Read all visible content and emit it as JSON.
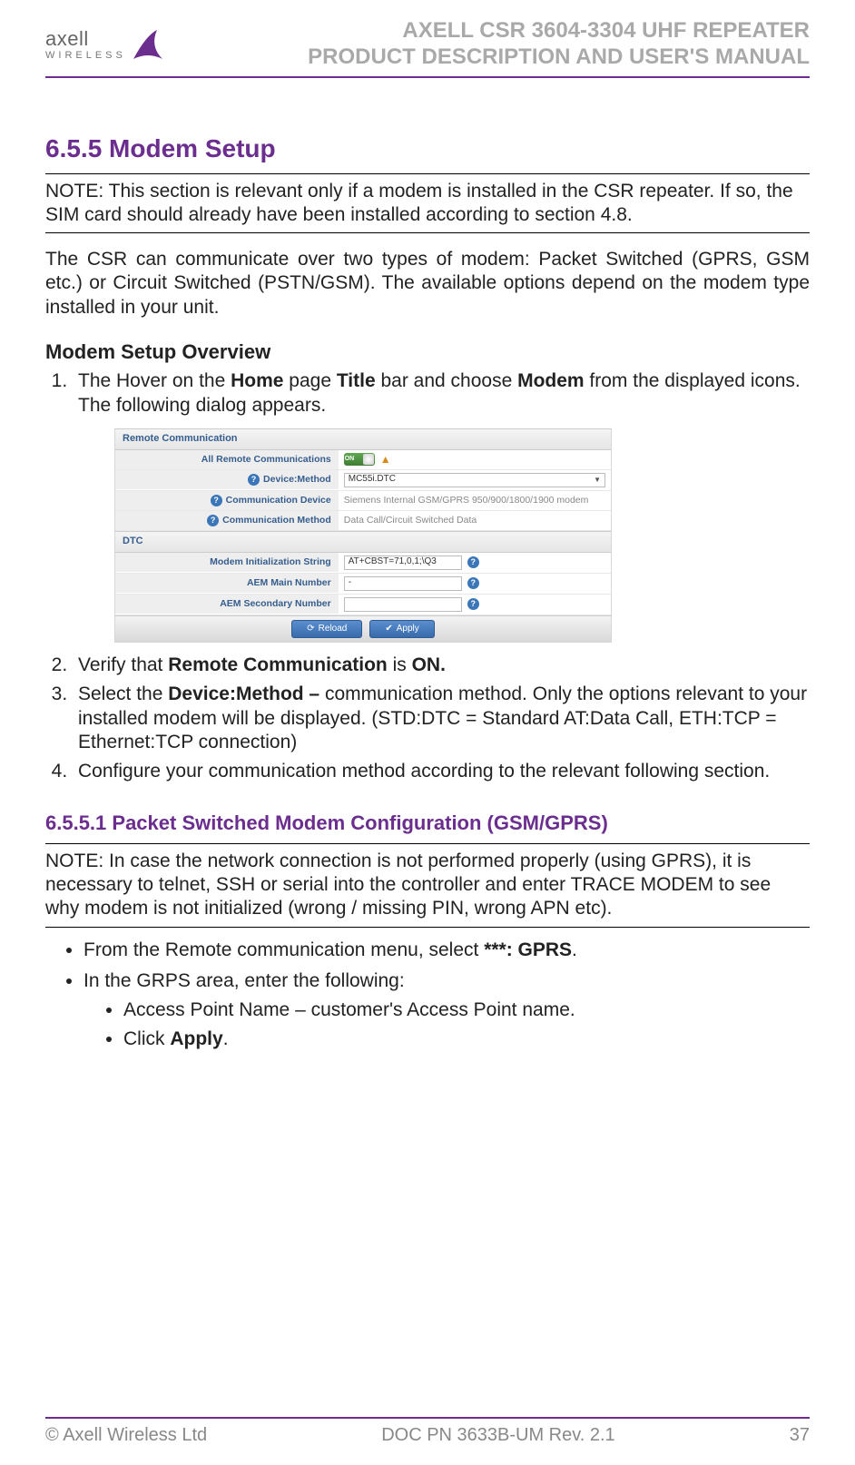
{
  "header": {
    "company": "axell",
    "subbrand": "WIRELESS",
    "title_line1": "AXELL CSR 3604-3304 UHF REPEATER",
    "title_line2": "PRODUCT DESCRIPTION AND USER'S MANUAL"
  },
  "section": {
    "number_title": "6.5.5 Modem Setup",
    "note": "NOTE: This section is relevant only if a modem is installed in the CSR repeater. If so, the SIM card should already have been installed according to section 4.8.",
    "intro": "The CSR can communicate over two types of modem: Packet Switched (GPRS, GSM etc.) or Circuit Switched (PSTN/GSM). The available options depend on the modem type installed in your unit.",
    "overview_head": "Modem Setup Overview",
    "steps": {
      "s1_a": "The Hover on the ",
      "s1_b": "Home",
      "s1_c": " page ",
      "s1_d": "Title",
      "s1_e": " bar and choose ",
      "s1_f": "Modem",
      "s1_g": " from the displayed icons. The following dialog appears.",
      "s2_a": "Verify that ",
      "s2_b": "Remote Communication",
      "s2_c": " is ",
      "s2_d": "ON.",
      "s3_a": "Select the ",
      "s3_b": "Device:Method – ",
      "s3_c": "communication method. Only the options relevant to your installed modem will be displayed. (STD:DTC = Standard AT:Data Call, ETH:TCP = Ethernet:TCP connection)",
      "s4": "Configure your communication method according to the relevant following section."
    }
  },
  "ui": {
    "panel1_title": "Remote Communication",
    "row1_label": "All Remote Communications",
    "row1_toggle": "ON",
    "row2_label": "Device:Method",
    "row2_value": "MC55i.DTC",
    "row3_label": "Communication Device",
    "row3_value": "Siemens Internal GSM/GPRS 950/900/1800/1900 modem",
    "row4_label": "Communication Method",
    "row4_value": "Data Call/Circuit Switched Data",
    "panel2_title": "DTC",
    "row5_label": "Modem Initialization String",
    "row5_value": "AT+CBST=71,0,1;\\Q3",
    "row6_label": "AEM Main Number",
    "row6_value": "-",
    "row7_label": "AEM Secondary Number",
    "row7_value": "",
    "btn_reload": "Reload",
    "btn_apply": "Apply"
  },
  "subsection": {
    "title": "6.5.5.1   Packet Switched Modem Configuration (GSM/GPRS)",
    "note": "NOTE: In case the network connection is not performed properly (using GPRS), it is necessary to telnet, SSH or serial into the controller and enter TRACE MODEM to see why modem is not initialized (wrong / missing PIN, wrong APN etc).",
    "b1_a": "From the Remote communication menu, select ",
    "b1_b": "***: GPRS",
    "b1_c": ".",
    "b2": "In the GRPS area, enter the following:",
    "sb1": " Access Point Name – customer's Access Point name.",
    "sb2_a": "Click ",
    "sb2_b": "Apply",
    "sb2_c": "."
  },
  "footer": {
    "left": "© Axell Wireless Ltd",
    "center": "DOC PN 3633B-UM Rev. 2.1",
    "right": "37"
  }
}
